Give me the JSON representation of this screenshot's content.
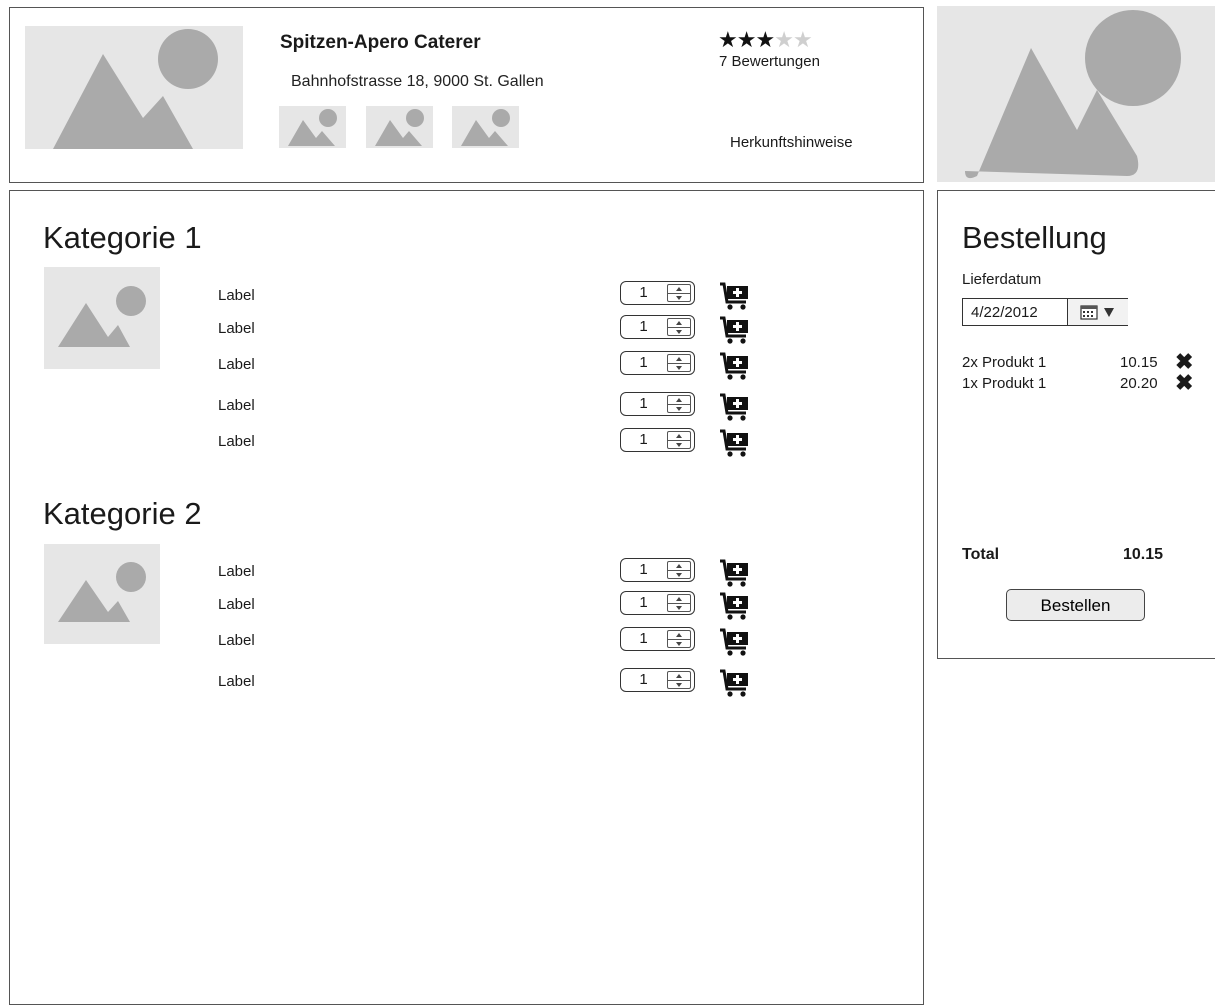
{
  "header": {
    "title": "Spitzen-Apero Caterer",
    "address": "Bahnhofstrasse 18, 9000 St. Gallen",
    "rating": 3,
    "rating_max": 5,
    "reviews": "7 Bewertungen",
    "source_hint": "Herkunftshinweise"
  },
  "categories": [
    {
      "title": "Kategorie 1",
      "items": [
        {
          "label": "Label",
          "qty": "1"
        },
        {
          "label": "Label",
          "qty": "1"
        },
        {
          "label": "Label",
          "qty": "1"
        },
        {
          "label": "Label",
          "qty": "1"
        },
        {
          "label": "Label",
          "qty": "1"
        }
      ]
    },
    {
      "title": "Kategorie 2",
      "items": [
        {
          "label": "Label",
          "qty": "1"
        },
        {
          "label": "Label",
          "qty": "1"
        },
        {
          "label": "Label",
          "qty": "1"
        },
        {
          "label": "Label",
          "qty": "1"
        }
      ]
    }
  ],
  "order": {
    "title": "Bestellung",
    "date_label": "Lieferdatum",
    "date_value": "4/22/2012",
    "items": [
      {
        "desc": "2x Produkt 1",
        "price": "10.15"
      },
      {
        "desc": "1x Produkt 1",
        "price": "20.20"
      }
    ],
    "total_label": "Total",
    "total_value": "10.15",
    "submit_label": "Bestellen"
  },
  "colors": {
    "placeholder_bg": "#e6e6e6",
    "placeholder_shape": "#aaaaaa",
    "star_on": "#111111",
    "star_off": "#cfcfcf"
  }
}
